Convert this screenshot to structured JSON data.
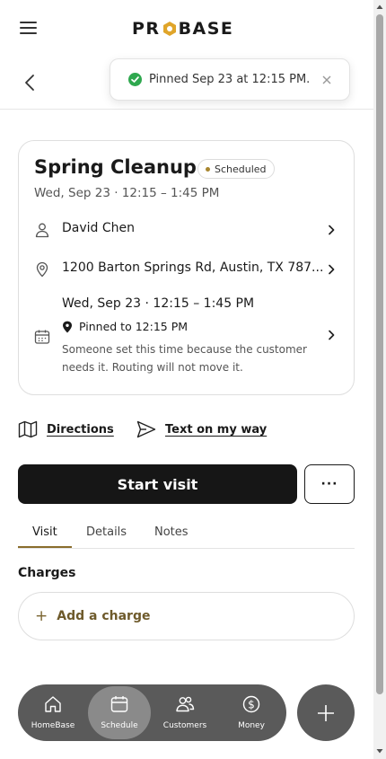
{
  "app": {
    "logo_text": "PROBASE",
    "logo_left": "PR",
    "logo_right": "BASE"
  },
  "toast": {
    "message": "Pinned Sep 23 at 12:15 PM."
  },
  "card": {
    "title": "Spring Cleanup",
    "status_badge": "Scheduled",
    "subtitle": "Wed, Sep 23 · 12:15 – 1:45 PM",
    "customer": "David Chen",
    "address": "1200 Barton Springs Rd, Austin, TX 787...",
    "schedule": {
      "time": "Wed, Sep 23 · 12:15 – 1:45 PM",
      "pinned_label": "Pinned to 12:15 PM",
      "note": "Someone set this time because the customer needs it. Routing will not move it."
    }
  },
  "actions": {
    "directions": "Directions",
    "text_on_my_way": "Text on my way"
  },
  "buttons": {
    "start_visit": "Start visit",
    "more": "···"
  },
  "tabs": [
    {
      "label": "Visit",
      "active": true
    },
    {
      "label": "Details",
      "active": false
    },
    {
      "label": "Notes",
      "active": false
    }
  ],
  "charges": {
    "title": "Charges",
    "add_label": "Add a charge",
    "add_symbol": "+"
  },
  "bottom_nav": [
    {
      "label": "HomeBase",
      "icon": "home-icon",
      "active": false
    },
    {
      "label": "Schedule",
      "icon": "calendar-icon",
      "active": true
    },
    {
      "label": "Customers",
      "icon": "customers-icon",
      "active": false
    },
    {
      "label": "Money",
      "icon": "dollar-icon",
      "active": false
    }
  ],
  "colors": {
    "accent": "#8a6d2c",
    "success": "#2fa84f",
    "dark": "#161616",
    "nav": "#5a5a5a"
  }
}
